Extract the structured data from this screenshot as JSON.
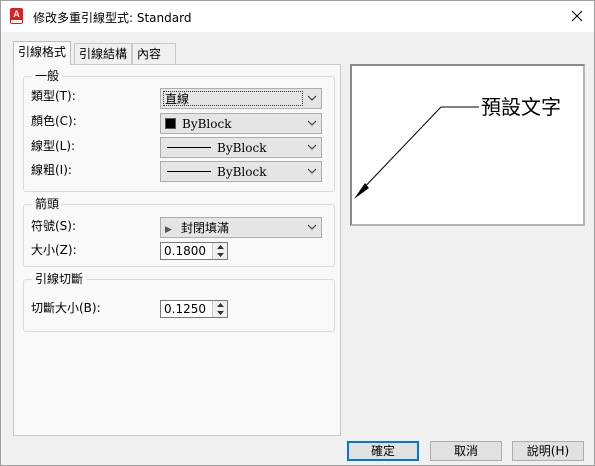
{
  "window": {
    "title": "修改多重引線型式: Standard"
  },
  "tabs": [
    {
      "label": "引線格式",
      "active": true
    },
    {
      "label": "引線結構",
      "active": false
    },
    {
      "label": "內容",
      "active": false
    }
  ],
  "general": {
    "legend": "一般",
    "type_label": "類型(T):",
    "type_value": "直線",
    "color_label": "顏色(C):",
    "color_value": "ByBlock",
    "color_swatch": "#000000",
    "linetype_label": "線型(L):",
    "linetype_value": "ByBlock",
    "lineweight_label": "線粗(I):",
    "lineweight_value": "ByBlock"
  },
  "arrowhead": {
    "legend": "箭頭",
    "symbol_label": "符號(S):",
    "symbol_value": "封閉填滿",
    "size_label": "大小(Z):",
    "size_value": "0.1800"
  },
  "landing_break": {
    "legend": "引線切斷",
    "break_size_label": "切斷大小(B):",
    "break_size_value": "0.1250"
  },
  "preview": {
    "label": "預設文字"
  },
  "buttons": {
    "ok": "確定",
    "cancel": "取消",
    "help": "說明(H)"
  }
}
